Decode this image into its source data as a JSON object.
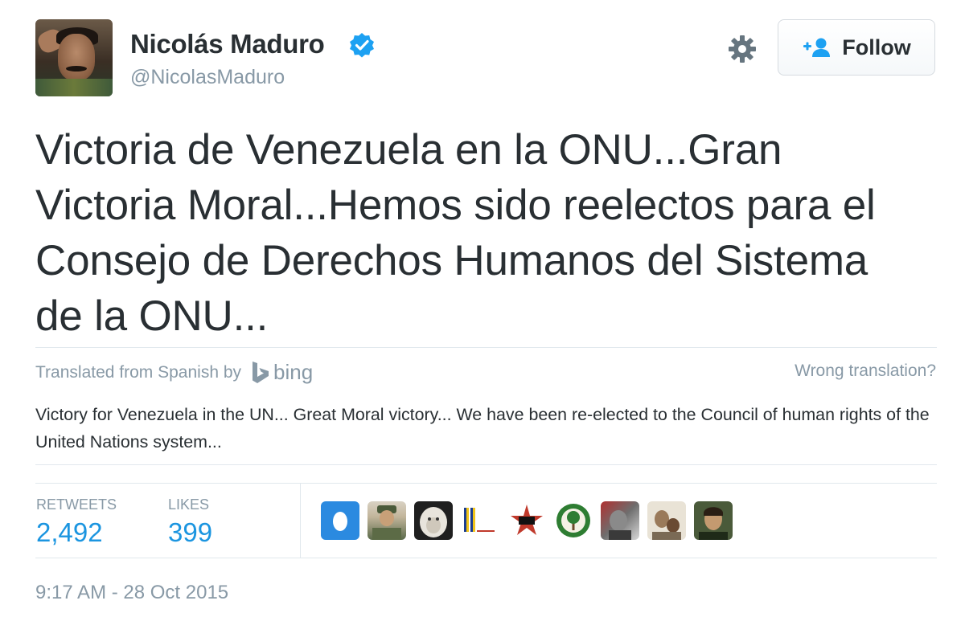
{
  "user": {
    "name": "Nicolás Maduro",
    "handle": "@NicolasMaduro",
    "verified": true
  },
  "actions": {
    "follow_label": "Follow"
  },
  "tweet": {
    "lines": [
      "Victoria de Venezuela en la ONU...Gran",
      "Victoria Moral...Hemos sido reelectos para el",
      "Consejo de Derechos Humanos del Sistema",
      "de la ONU..."
    ],
    "timestamp": "9:17 AM - 28 Oct 2015"
  },
  "translation": {
    "prefix": "Translated from Spanish by",
    "provider": "bing",
    "wrong_label": "Wrong translation?",
    "text": "Victory for Venezuela in the UN... Great Moral victory... We have been re-elected to the Council of human rights of the United Nations system..."
  },
  "stats": {
    "retweets_label": "RETWEETS",
    "retweets_value": "2,492",
    "likes_label": "LIKES",
    "likes_value": "399"
  },
  "colors": {
    "accent": "#1b95e0",
    "verified": "#1da1f2",
    "muted": "#8899a6",
    "text": "#292f33"
  }
}
